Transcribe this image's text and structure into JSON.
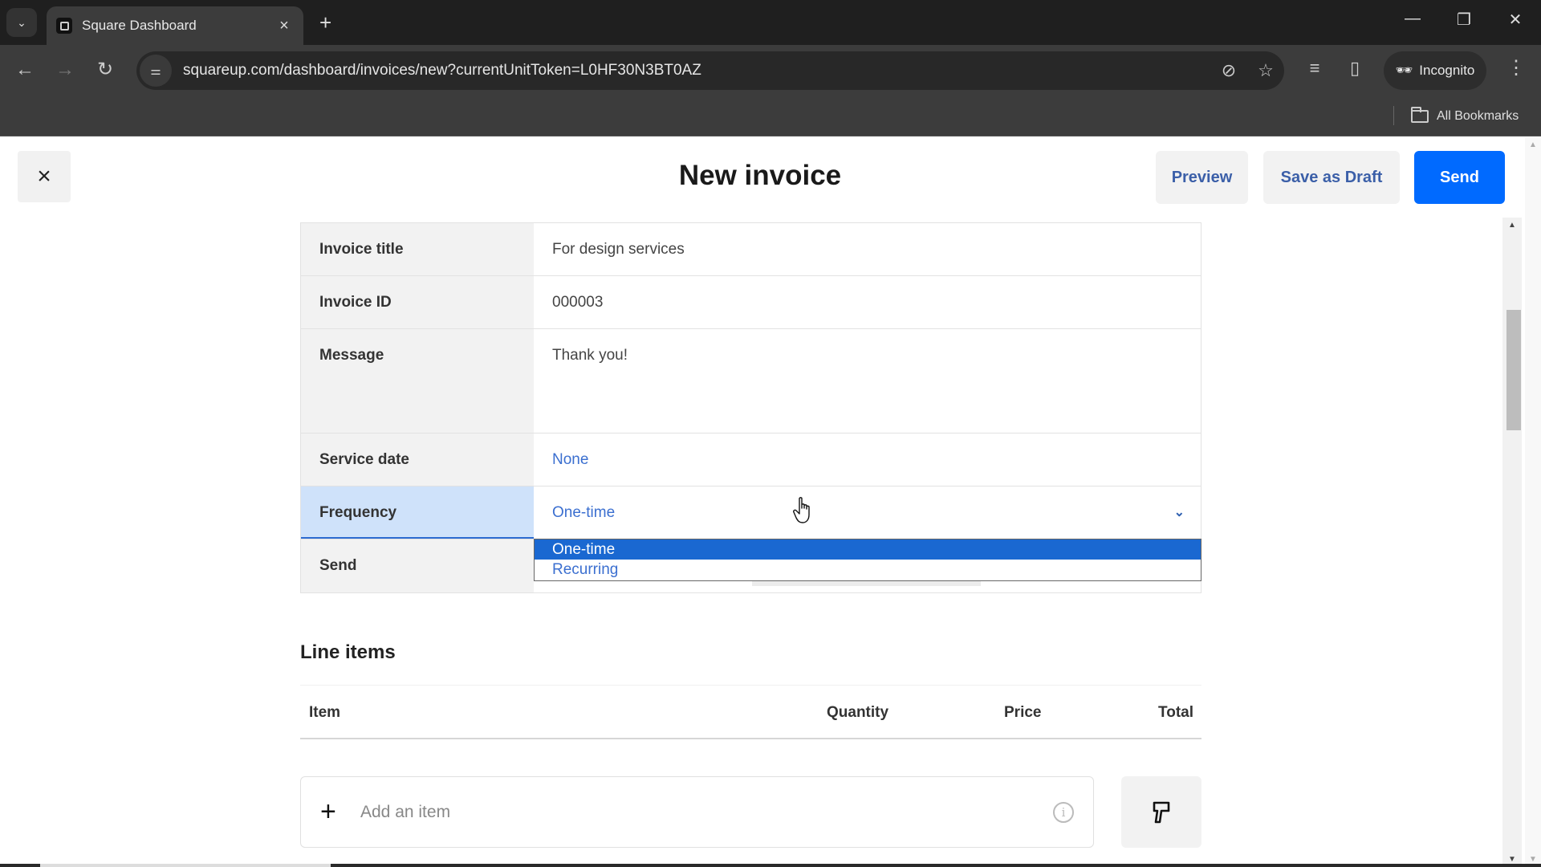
{
  "browser": {
    "tab": {
      "title": "Square Dashboard",
      "favicon": "square-logo-icon"
    },
    "url": "squareup.com/dashboard/invoices/new?currentUnitToken=L0HF30N3BT0AZ",
    "profile_label": "Incognito",
    "bookmarks_label": "All Bookmarks",
    "icons": {
      "tab_list": "chevron-down-icon",
      "new_tab": "plus-icon",
      "back": "arrow-left-icon",
      "forward": "arrow-right-icon",
      "reload": "reload-icon",
      "site_info": "tune-icon",
      "eye_off": "eye-off-icon",
      "bookmark": "star-icon",
      "media": "media-queue-icon",
      "side_panel": "side-panel-icon",
      "menu": "kebab-menu-icon"
    }
  },
  "header": {
    "title": "New invoice",
    "close_label": "×",
    "buttons": {
      "preview": "Preview",
      "save_draft": "Save as Draft",
      "send": "Send"
    }
  },
  "form": {
    "rows": [
      {
        "label": "Invoice title",
        "value": "For design services"
      },
      {
        "label": "Invoice ID",
        "value": "000003"
      },
      {
        "label": "Message",
        "value": "Thank you!"
      },
      {
        "label": "Service date",
        "value": "None"
      },
      {
        "label": "Frequency",
        "value": "One-time"
      },
      {
        "label": "Send",
        "value": ""
      }
    ],
    "frequency_dropdown": {
      "options": [
        "One-time",
        "Recurring"
      ],
      "selected": "One-time"
    }
  },
  "line_items": {
    "title": "Line items",
    "columns": [
      "Item",
      "Quantity",
      "Price",
      "Total"
    ],
    "add_item_placeholder": "Add an item"
  },
  "colors": {
    "primary": "#006aff",
    "link": "#3b6fd0",
    "dropdown_selected": "#1a68d1",
    "active_row": "#cfe2fa"
  }
}
